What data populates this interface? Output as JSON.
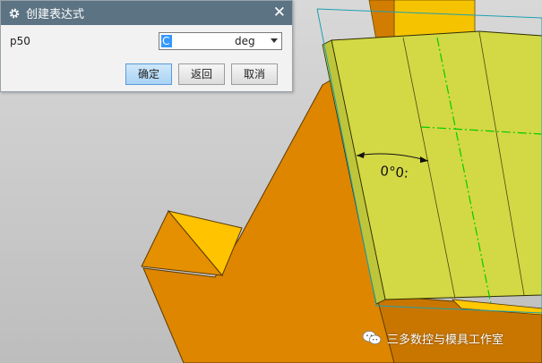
{
  "dialog": {
    "title": "创建表达式",
    "param_label": "p50",
    "expression_value": "C",
    "unit": "deg",
    "buttons": {
      "ok": "确定",
      "back": "返回",
      "cancel": "取消"
    }
  },
  "viewport": {
    "angle_label": "0°0:"
  },
  "watermark": "三多数控与模具工作室",
  "colors": {
    "titlebar": "#5c7383",
    "selected_face": "#d2d846",
    "orange_body": "#e08800",
    "yellow_face": "#ffc000",
    "background": "#cfcfcf"
  }
}
